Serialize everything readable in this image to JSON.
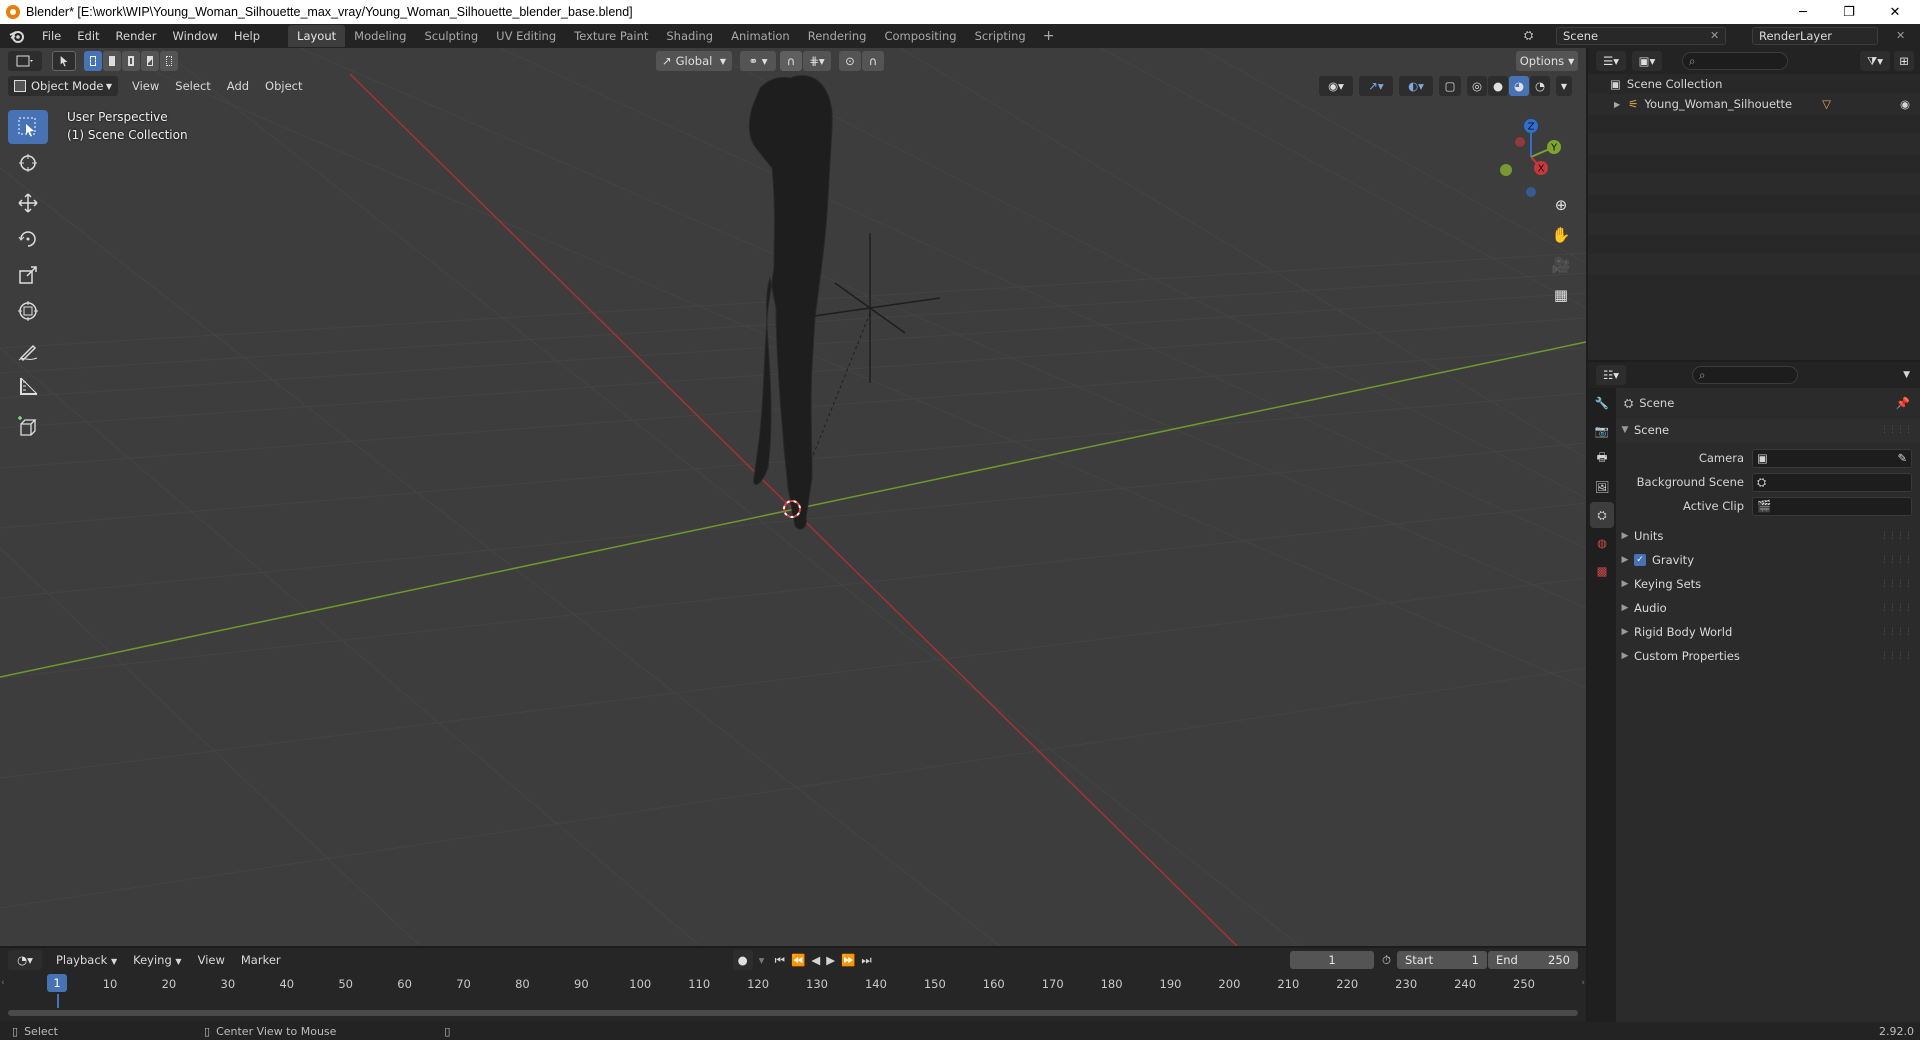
{
  "window": {
    "title": "Blender* [E:\\work\\WIP\\Young_Woman_Silhouette_max_vray/Young_Woman_Silhouette_blender_base.blend]",
    "controls": {
      "minimize": "─",
      "restore": "❐",
      "close": "✕"
    }
  },
  "menus": [
    "File",
    "Edit",
    "Render",
    "Window",
    "Help"
  ],
  "workspaces": [
    "Layout",
    "Modeling",
    "Sculpting",
    "UV Editing",
    "Texture Paint",
    "Shading",
    "Animation",
    "Rendering",
    "Compositing",
    "Scripting"
  ],
  "active_workspace": "Layout",
  "add_workspace": "+",
  "scene_selector": {
    "value": "Scene"
  },
  "view_layer_selector": {
    "value": "RenderLayer"
  },
  "viewport": {
    "transform_orientation": "Global",
    "options_label": "Options",
    "mode": "Object Mode",
    "menus": [
      "View",
      "Select",
      "Add",
      "Object"
    ],
    "overlay_line1": "User Perspective",
    "overlay_line2": "(1) Scene Collection",
    "gizmo_labels": {
      "z": "Z",
      "y": "Y",
      "x": "X"
    }
  },
  "timeline": {
    "menus": [
      "Playback",
      "Keying",
      "View",
      "Marker"
    ],
    "current_frame": "1",
    "start_label": "Start",
    "start_value": "1",
    "end_label": "End",
    "end_value": "250",
    "ruler": [
      "1",
      "10",
      "20",
      "30",
      "40",
      "50",
      "60",
      "70",
      "80",
      "90",
      "100",
      "110",
      "120",
      "130",
      "140",
      "150",
      "160",
      "170",
      "180",
      "190",
      "200",
      "210",
      "220",
      "230",
      "240",
      "250"
    ]
  },
  "status": {
    "select": "Select",
    "center": "Center View to Mouse",
    "version": "2.92.0"
  },
  "outliner": {
    "root": "Scene Collection",
    "items": [
      {
        "name": "Young_Woman_Silhouette"
      }
    ]
  },
  "properties": {
    "header": "Scene",
    "section": "Scene",
    "fields": [
      {
        "label": "Camera",
        "value": ""
      },
      {
        "label": "Background Scene",
        "value": ""
      },
      {
        "label": "Active Clip",
        "value": ""
      }
    ],
    "panels": [
      "Units",
      "Gravity",
      "Keying Sets",
      "Audio",
      "Rigid Body World",
      "Custom Properties"
    ],
    "gravity_checked": true
  },
  "colors": {
    "accent": "#4772b3",
    "x_axis": "#c0393d",
    "y_axis": "#6e9a2c",
    "background": "#3d3d3d"
  }
}
